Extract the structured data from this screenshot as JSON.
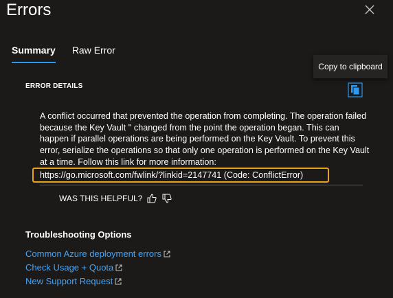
{
  "panel": {
    "title": "Errors"
  },
  "tabs": [
    {
      "label": "Summary",
      "active": true
    },
    {
      "label": "Raw Error",
      "active": false
    }
  ],
  "tooltip": {
    "text": "Copy to clipboard"
  },
  "error_details": {
    "heading": "ERROR DETAILS",
    "message": "A conflict occurred that prevented the operation from completing. The operation failed because the Key Vault '' changed from the point the operation began. This can happen if parallel operations are being performed on the Key Vault. To prevent this error, serialize the operations so that only one operation is performed on the Key Vault at a time. Follow this link for more information:",
    "link_text": "https://go.microsoft.com/fwlink/?linkid=2147741 (Code: ConflictError)"
  },
  "feedback": {
    "prompt": "WAS THIS HELPFUL?"
  },
  "troubleshooting": {
    "heading": "Troubleshooting Options",
    "links": [
      {
        "label": "Common Azure deployment errors"
      },
      {
        "label": "Check Usage + Quota"
      },
      {
        "label": "New Support Request"
      }
    ]
  },
  "colors": {
    "background": "#1b1a19",
    "accent": "#2899f5",
    "link": "#3ea6ff",
    "highlight": "#e8a318"
  },
  "icons": {
    "close": "close-icon",
    "copy": "copy-icon",
    "thumbs_up": "thumbs-up-icon",
    "thumbs_down": "thumbs-down-icon",
    "external": "external-link-icon"
  }
}
